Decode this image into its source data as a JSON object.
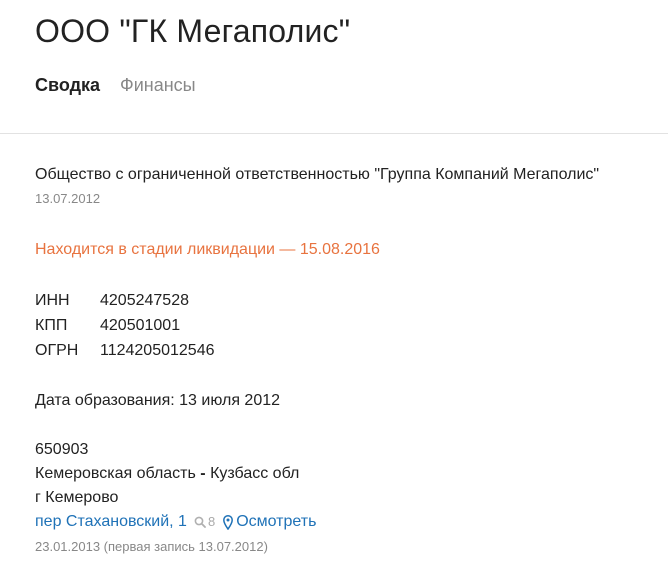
{
  "company": {
    "title": "ООО \"ГК Мегаполис\""
  },
  "tabs": [
    {
      "label": "Сводка",
      "active": true
    },
    {
      "label": "Финансы",
      "active": false
    }
  ],
  "summary": {
    "full_name": "Общество с ограниченной ответственностью \"Группа Компаний Мегаполис\"",
    "full_name_date": "13.07.2012",
    "status": "Находится в стадии ликвидации — 15.08.2016",
    "status_color": "#e8733f",
    "codes": [
      {
        "label": "ИНН",
        "value": "4205247528"
      },
      {
        "label": "КПП",
        "value": "420501001"
      },
      {
        "label": "ОГРН",
        "value": "1124205012546"
      }
    ],
    "founded": "Дата образования: 13 июля 2012",
    "address": {
      "postal_code": "650903",
      "region_name": "Кемеровская область",
      "region_separator": " - ",
      "region_short": "Кузбасс обл",
      "city": "г Кемерово",
      "street": "пер Стахановский, 1",
      "search_count": "8",
      "view_label": "Осмотреть",
      "date_note": "23.01.2013 (первая запись 13.07.2012)"
    }
  },
  "colors": {
    "link": "#1f72b7",
    "muted": "#888888",
    "text": "#222222"
  },
  "icons": {
    "search": "search-icon",
    "map_pin": "map-pin-icon"
  }
}
